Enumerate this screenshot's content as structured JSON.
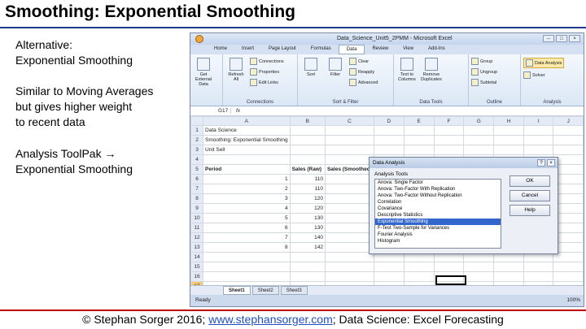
{
  "slide": {
    "title": "Smoothing: Exponential Smoothing",
    "para1": [
      "Alternative:",
      "Exponential Smoothing"
    ],
    "para2": [
      "Similar to Moving Averages",
      "but gives higher weight",
      "to recent data"
    ],
    "para3": [
      "Analysis ToolPak →",
      "Exponential Smoothing"
    ],
    "footer_pre": "© Stephan Sorger 2016; ",
    "footer_link": "www.stephansorger.com",
    "footer_post": "; Data Science: Excel Forecasting"
  },
  "excel": {
    "window_title": "Data_Science_Unit5_2PMM - Microsoft Excel",
    "tabs": [
      "Home",
      "Insert",
      "Page Layout",
      "Formulas",
      "Data",
      "Review",
      "View",
      "Add-Ins"
    ],
    "active_tab": "Data",
    "ribbon": {
      "get_external": "Get External Data",
      "refresh": "Refresh All",
      "connections": "Connections",
      "properties": "Properties",
      "edit_links": "Edit Links",
      "connections_group": "Connections",
      "sort": "Sort",
      "filter": "Filter",
      "clear": "Clear",
      "reapply": "Reapply",
      "advanced": "Advanced",
      "sort_group": "Sort & Filter",
      "text_to_columns": "Text to Columns",
      "remove_duplicates": "Remove Duplicates",
      "data_tools_group": "Data Tools",
      "group": "Group",
      "ungroup": "Ungroup",
      "subtotal": "Subtotal",
      "outline_group": "Outline",
      "data_analysis": "Data Analysis",
      "solver": "Solver",
      "analysis_group": "Analysis"
    },
    "name_box": "G17",
    "fx": "fx",
    "columns": [
      "A",
      "B",
      "C",
      "D",
      "E",
      "F",
      "G",
      "H",
      "I",
      "J"
    ],
    "rows": [
      {
        "n": "1",
        "cells": [
          "Data Science",
          "",
          "",
          "",
          "",
          "",
          "",
          "",
          "",
          ""
        ]
      },
      {
        "n": "2",
        "cells": [
          "Smoothing: Exponential Smoothing",
          "",
          "",
          "",
          "",
          "",
          "",
          "",
          "",
          ""
        ]
      },
      {
        "n": "3",
        "cells": [
          "Unit Sell",
          "",
          "",
          "",
          "",
          "",
          "",
          "",
          "",
          ""
        ]
      },
      {
        "n": "4",
        "cells": [
          "",
          "",
          "",
          "",
          "",
          "",
          "",
          "",
          "",
          ""
        ]
      },
      {
        "n": "5",
        "cells": [
          "Period",
          "Sales (Raw)",
          "Sales (Smoothed)",
          "",
          "",
          "",
          "",
          "",
          "",
          ""
        ]
      },
      {
        "n": "6",
        "cells": [
          "1",
          "110",
          "",
          "",
          "",
          "",
          "",
          "",
          "",
          ""
        ]
      },
      {
        "n": "7",
        "cells": [
          "2",
          "110",
          "",
          "",
          "",
          "",
          "",
          "",
          "",
          ""
        ]
      },
      {
        "n": "8",
        "cells": [
          "3",
          "120",
          "",
          "",
          "",
          "",
          "",
          "",
          "",
          ""
        ]
      },
      {
        "n": "9",
        "cells": [
          "4",
          "120",
          "",
          "",
          "",
          "",
          "",
          "",
          "",
          ""
        ]
      },
      {
        "n": "10",
        "cells": [
          "5",
          "130",
          "",
          "",
          "",
          "",
          "",
          "",
          "",
          ""
        ]
      },
      {
        "n": "11",
        "cells": [
          "6",
          "130",
          "",
          "",
          "",
          "",
          "",
          "",
          "",
          ""
        ]
      },
      {
        "n": "12",
        "cells": [
          "7",
          "140",
          "",
          "",
          "",
          "",
          "",
          "",
          "",
          ""
        ]
      },
      {
        "n": "13",
        "cells": [
          "8",
          "142",
          "",
          "",
          "",
          "",
          "",
          "",
          "",
          ""
        ]
      },
      {
        "n": "14",
        "cells": [
          "",
          "",
          "",
          "",
          "",
          "",
          "",
          "",
          "",
          ""
        ]
      },
      {
        "n": "15",
        "cells": [
          "",
          "",
          "",
          "",
          "",
          "",
          "",
          "",
          "",
          ""
        ]
      },
      {
        "n": "16",
        "cells": [
          "",
          "",
          "",
          "",
          "",
          "",
          "",
          "",
          "",
          ""
        ]
      },
      {
        "n": "17",
        "cells": [
          "",
          "",
          "",
          "",
          "",
          "",
          "",
          "",
          "",
          ""
        ]
      }
    ],
    "sheet_tabs": [
      "Sheet1",
      "Sheet2",
      "Sheet3"
    ],
    "status_ready": "Ready",
    "zoom": "100%"
  },
  "dialog": {
    "title": "Data Analysis",
    "tools_label": "Analysis Tools",
    "tools": [
      "Anova: Single Factor",
      "Anova: Two-Factor With Replication",
      "Anova: Two-Factor Without Replication",
      "Correlation",
      "Covariance",
      "Descriptive Statistics",
      "Exponential Smoothing",
      "F-Test Two-Sample for Variances",
      "Fourier Analysis",
      "Histogram"
    ],
    "selected": "Exponential Smoothing",
    "ok": "OK",
    "cancel": "Cancel",
    "help": "Help"
  }
}
